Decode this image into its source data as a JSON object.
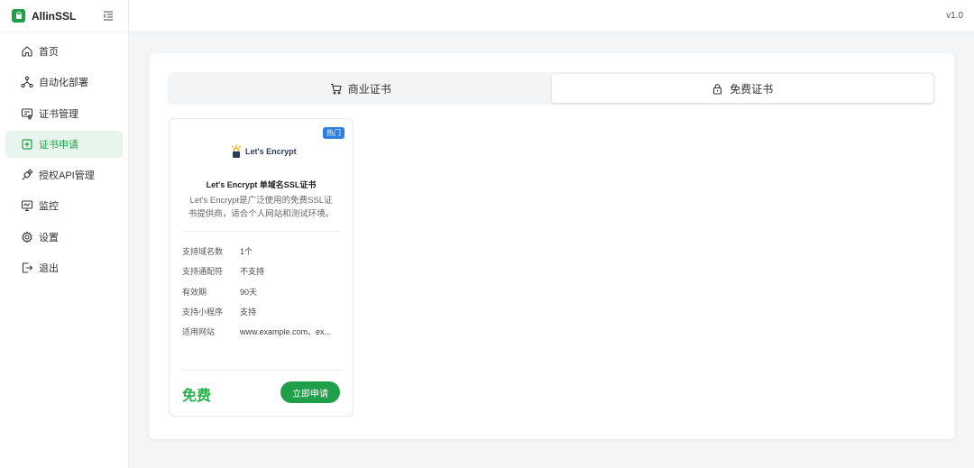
{
  "app": {
    "name": "AllinSSL",
    "version": "v1.0"
  },
  "sidebar": {
    "items": [
      {
        "label": "首页",
        "icon": "home-icon",
        "active": false
      },
      {
        "label": "自动化部署",
        "icon": "workflow-icon",
        "active": false
      },
      {
        "label": "证书管理",
        "icon": "certificate-icon",
        "active": false
      },
      {
        "label": "证书申请",
        "icon": "add-square-icon",
        "active": true
      },
      {
        "label": "授权API管理",
        "icon": "api-plug-icon",
        "active": false
      },
      {
        "label": "监控",
        "icon": "monitor-icon",
        "active": false
      },
      {
        "label": "设置",
        "icon": "gear-icon",
        "active": false
      },
      {
        "label": "退出",
        "icon": "logout-icon",
        "active": false
      }
    ]
  },
  "tabs": [
    {
      "label": "商业证书",
      "icon": "cart-icon",
      "active": false
    },
    {
      "label": "免费证书",
      "icon": "lock-icon",
      "active": true
    }
  ],
  "card": {
    "badge": "热门",
    "logo_text": "Let's Encrypt",
    "title": "Let's Encrypt 单域名SSL证书",
    "description": "Let's Encrypt是广泛使用的免费SSL证书提供商，适合个人网站和测试环境。",
    "specs": [
      {
        "label": "支持域名数",
        "value": "1个"
      },
      {
        "label": "支持通配符",
        "value": "不支持"
      },
      {
        "label": "有效期",
        "value": "90天"
      },
      {
        "label": "支持小程序",
        "value": "支持"
      },
      {
        "label": "适用网站",
        "value": "www.example.com、ex..."
      }
    ],
    "price": "免费",
    "apply_label": "立即申请"
  },
  "colors": {
    "brand": "#1f9f4a",
    "price": "#27b24a",
    "badge": "#2f7fe0",
    "active_bg": "#e8f5ec"
  }
}
